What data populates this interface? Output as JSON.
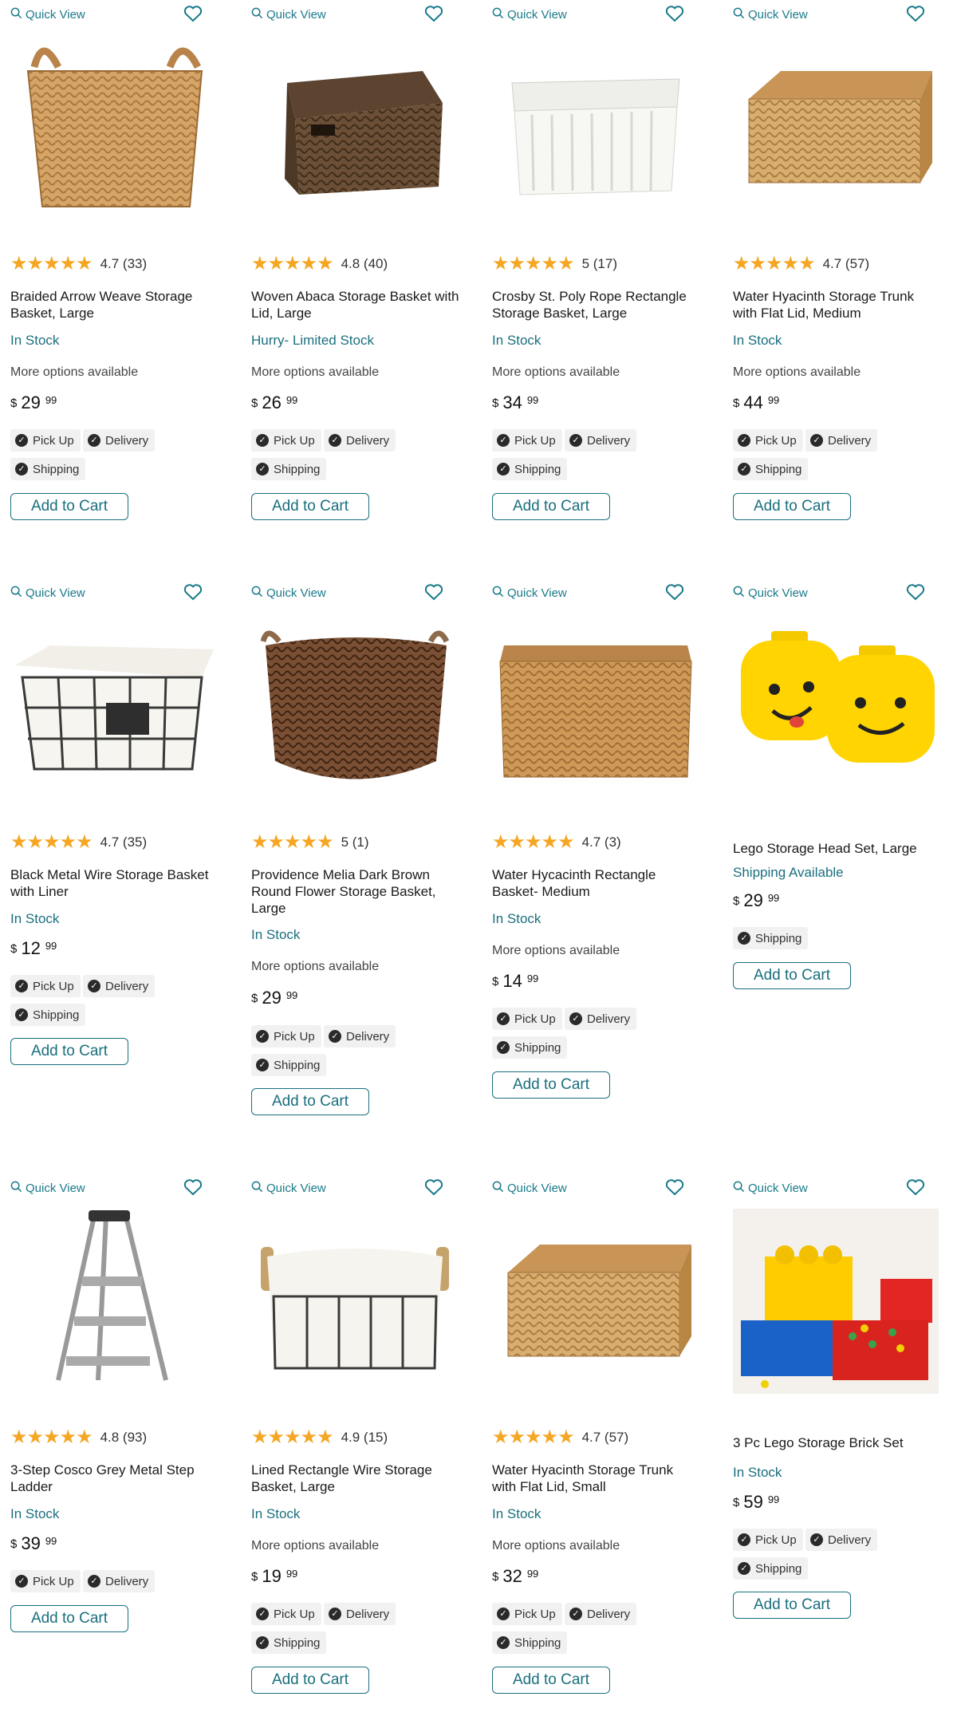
{
  "labels": {
    "quick_view": "Quick View",
    "add_to_cart": "Add to Cart",
    "currency": "$",
    "pickup": "Pick Up",
    "delivery": "Delivery",
    "shipping": "Shipping",
    "more_options": "More options available"
  },
  "colors": {
    "accent": "#1a7a8a",
    "star": "#f5a623"
  },
  "products": [
    {
      "title": "Braided Arrow Weave Storage Basket, Large",
      "rating": "4.7 (33)",
      "stars": 5,
      "stock": "In Stock",
      "more": true,
      "price_dollars": "29",
      "price_cents": "99",
      "badges": [
        "pickup",
        "delivery",
        "shipping"
      ],
      "image": "tall-woven-basket-icon"
    },
    {
      "title": "Woven Abaca Storage Basket with Lid, Large",
      "rating": "4.8 (40)",
      "stars": 5,
      "stock": "Hurry- Limited Stock",
      "more": true,
      "price_dollars": "26",
      "price_cents": "99",
      "badges": [
        "pickup",
        "delivery",
        "shipping"
      ],
      "image": "dark-lidded-basket-icon"
    },
    {
      "title": "Crosby St. Poly Rope Rectangle Storage Basket, Large",
      "rating": "5 (17)",
      "stars": 5,
      "stock": "In Stock",
      "more": true,
      "price_dollars": "34",
      "price_cents": "99",
      "badges": [
        "pickup",
        "delivery",
        "shipping"
      ],
      "image": "white-rope-basket-icon"
    },
    {
      "title": "Water Hyacinth Storage Trunk with Flat Lid, Medium",
      "rating": "4.7 (57)",
      "stars": 5,
      "stock": "In Stock",
      "more": true,
      "price_dollars": "44",
      "price_cents": "99",
      "badges": [
        "pickup",
        "delivery",
        "shipping"
      ],
      "image": "woven-trunk-icon"
    },
    {
      "title": "Black Metal Wire Storage Basket with Liner",
      "rating": "4.7 (35)",
      "stars": 5,
      "stock": "In Stock",
      "more": false,
      "price_dollars": "12",
      "price_cents": "99",
      "badges": [
        "pickup",
        "delivery",
        "shipping"
      ],
      "image": "wire-basket-liner-icon"
    },
    {
      "title": "Providence Melia Dark Brown Round Flower Storage Basket, Large",
      "rating": "5 (1)",
      "stars": 5,
      "stock": "In Stock",
      "more": true,
      "price_dollars": "29",
      "price_cents": "99",
      "badges": [
        "pickup",
        "delivery",
        "shipping"
      ],
      "image": "round-brown-basket-icon"
    },
    {
      "title": "Water Hycacinth Rectangle Basket- Medium",
      "rating": "4.7 (3)",
      "stars": 5,
      "stock": "In Stock",
      "more": true,
      "price_dollars": "14",
      "price_cents": "99",
      "badges": [
        "pickup",
        "delivery",
        "shipping"
      ],
      "image": "rectangle-woven-basket-icon"
    },
    {
      "title": "Lego Storage Head Set, Large",
      "rating": "",
      "stars": 0,
      "stock": "Shipping Available",
      "more": false,
      "price_dollars": "29",
      "price_cents": "99",
      "badges": [
        "shipping"
      ],
      "image": "lego-heads-icon"
    },
    {
      "title": "3-Step Cosco Grey Metal Step Ladder",
      "rating": "4.8 (93)",
      "stars": 5,
      "stock": "In Stock",
      "more": false,
      "price_dollars": "39",
      "price_cents": "99",
      "badges": [
        "pickup",
        "delivery"
      ],
      "image": "step-ladder-icon"
    },
    {
      "title": "Lined Rectangle Wire Storage Basket, Large",
      "rating": "4.9 (15)",
      "stars": 5,
      "stock": "In Stock",
      "more": true,
      "price_dollars": "19",
      "price_cents": "99",
      "badges": [
        "pickup",
        "delivery",
        "shipping"
      ],
      "image": "lined-wire-basket-icon"
    },
    {
      "title": "Water Hyacinth Storage Trunk with Flat Lid, Small",
      "rating": "4.7 (57)",
      "stars": 5,
      "stock": "In Stock",
      "more": true,
      "price_dollars": "32",
      "price_cents": "99",
      "badges": [
        "pickup",
        "delivery",
        "shipping"
      ],
      "image": "woven-trunk-icon"
    },
    {
      "title": "3 Pc Lego Storage Brick Set",
      "rating": "",
      "stars": 0,
      "stock": "In Stock",
      "more": false,
      "price_dollars": "59",
      "price_cents": "99",
      "badges": [
        "pickup",
        "delivery",
        "shipping"
      ],
      "image": "lego-bricks-icon"
    }
  ]
}
